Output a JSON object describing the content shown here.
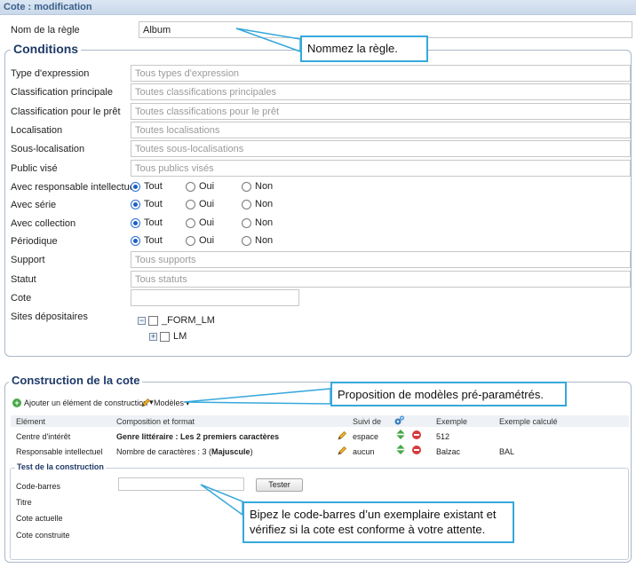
{
  "window": {
    "title": "Cote : modification"
  },
  "rule_name": {
    "label": "Nom de la règle",
    "value": "Album"
  },
  "conditions": {
    "legend": "Conditions",
    "fields": [
      {
        "label": "Type d'expression",
        "placeholder": "Tous types d'expression"
      },
      {
        "label": "Classification principale",
        "placeholder": "Toutes classifications principales"
      },
      {
        "label": "Classification pour le prêt",
        "placeholder": "Toutes classifications pour le prêt"
      },
      {
        "label": "Localisation",
        "placeholder": "Toutes localisations"
      },
      {
        "label": "Sous-localisation",
        "placeholder": "Toutes sous-localisations"
      },
      {
        "label": "Public visé",
        "placeholder": "Tous publics visés"
      }
    ],
    "radio_rows": [
      {
        "label": "Avec responsable intellectuel",
        "options": [
          "Tout",
          "Oui",
          "Non"
        ],
        "selected": "Tout"
      },
      {
        "label": "Avec série",
        "options": [
          "Tout",
          "Oui",
          "Non"
        ],
        "selected": "Tout"
      },
      {
        "label": "Avec collection",
        "options": [
          "Tout",
          "Oui",
          "Non"
        ],
        "selected": "Tout"
      },
      {
        "label": "Périodique",
        "options": [
          "Tout",
          "Oui",
          "Non"
        ],
        "selected": "Tout"
      }
    ],
    "support": {
      "label": "Support",
      "placeholder": "Tous supports"
    },
    "statut": {
      "label": "Statut",
      "placeholder": "Tous statuts"
    },
    "cote": {
      "label": "Cote",
      "value": ""
    },
    "sites": {
      "label": "Sites dépositaires",
      "tree": [
        "_FORM_LM",
        "LM"
      ]
    }
  },
  "construction": {
    "legend": "Construction de la cote",
    "add_label": "Ajouter un élément de construction",
    "models_label": "Modèles",
    "columns": [
      "Elément",
      "Composition et format",
      "Suivi de",
      "Exemple",
      "Exemple calculé"
    ],
    "rows": [
      {
        "element": "Centre d'intérêt",
        "composition": "Genre littéraire : Les 2 premiers caractères",
        "suivi": "espace",
        "exemple": "512",
        "calcule": ""
      },
      {
        "element": "Responsable intellectuel",
        "composition_prefix": "Nombre de caractères : 3 (",
        "composition_bold": "Majuscule",
        "composition_suffix": ")",
        "suivi": "aucun",
        "exemple": "Balzac",
        "calcule": "BAL"
      }
    ],
    "test": {
      "legend": "Test de la construction",
      "barcode_label": "Code-barres",
      "barcode_value": "",
      "button": "Tester",
      "titre_label": "Titre",
      "cote_actuelle_label": "Cote actuelle",
      "cote_construite_label": "Cote construite"
    }
  },
  "callouts": {
    "name": "Nommez la règle.",
    "models": "Proposition de modèles pré-paramétrés.",
    "barcode_line1": "Bipez le code-barres d’un exemplaire existant et",
    "barcode_line2": "vérifiez si la cote est conforme à votre attente."
  },
  "colors": {
    "callout_border": "#36a8dc",
    "legend": "#1f3a68",
    "radio_selected": "#1f5fc4"
  }
}
